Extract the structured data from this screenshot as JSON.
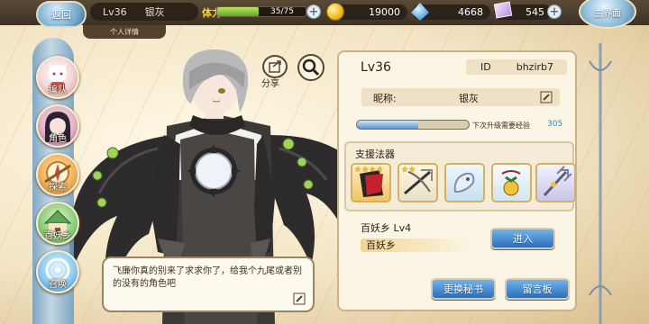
{
  "topbar": {
    "back_label": "返回",
    "level": "Lv36",
    "player_name": "银灰",
    "detail_tab": "个人详情",
    "stamina_label": "体力",
    "stamina_text": "35/75",
    "stamina_fraction": 0.47,
    "gold": "19000",
    "gems": "4668",
    "tickets": "545",
    "main_label": "主界面"
  },
  "side_menu": [
    {
      "label": "编队"
    },
    {
      "label": "角色"
    },
    {
      "label": "探索"
    },
    {
      "label": "百妖乡"
    },
    {
      "label": "召唤"
    }
  ],
  "share_label": "分享",
  "dialog_text": "飞廉你真的别来了求求你了，给我个九尾或者别的没有的角色吧",
  "profile": {
    "level": "Lv36",
    "id_label": "ID",
    "id_value": "bhzirb7",
    "nick_label": "昵称:",
    "nick_value": "银灰",
    "exp_label": "下次升级需要经验",
    "exp_value": "305",
    "exp_fraction": 0.55,
    "support_title": "支援法器",
    "support_items": [
      {
        "stars": "★★★★",
        "icon": "red-black-cloak-icon"
      },
      {
        "stars": "★★",
        "icon": "crossbow-icon"
      },
      {
        "stars": "",
        "icon": "silver-dragon-icon"
      },
      {
        "stars": "",
        "icon": "bell-pendant-icon"
      },
      {
        "stars": "",
        "icon": "trident-icon"
      }
    ],
    "village_line": "百妖乡  Lv4",
    "village_name": "百妖乡",
    "enter_label": "进入",
    "change_secretary_label": "更换秘书",
    "message_board_label": "留言板"
  }
}
